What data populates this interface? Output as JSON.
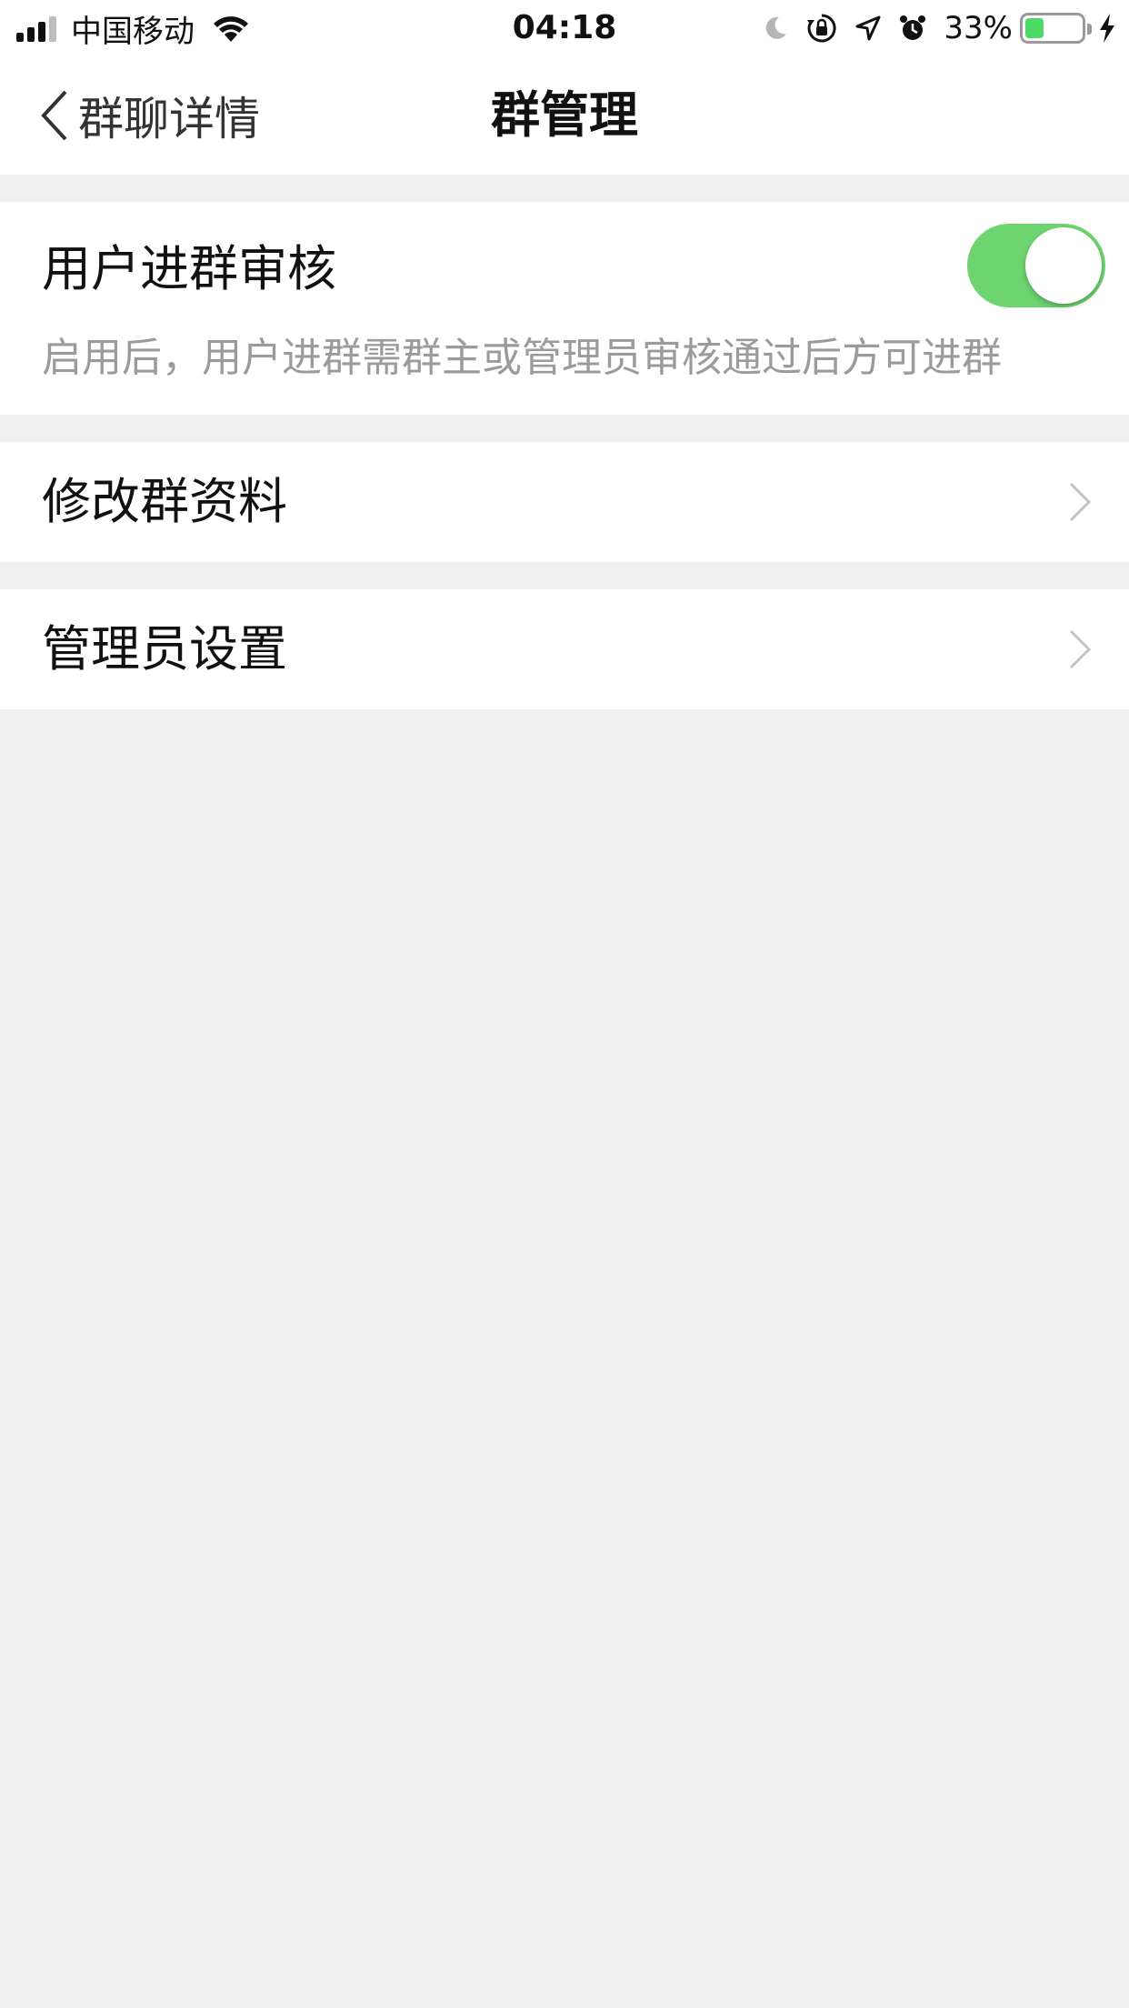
{
  "status_bar": {
    "carrier": "中国移动",
    "time": "04:18",
    "battery_percent": "33%",
    "battery_level": 0.33,
    "icons": [
      "signal-icon",
      "wifi-icon",
      "moon-icon",
      "orientation-lock-icon",
      "location-icon",
      "alarm-icon",
      "battery-icon",
      "charging-bolt-icon"
    ]
  },
  "nav": {
    "back_label": "群聊详情",
    "title": "群管理"
  },
  "settings": {
    "review": {
      "label": "用户进群审核",
      "description": "启用后，用户进群需群主或管理员审核通过后方可进群",
      "enabled": true
    },
    "edit_profile": {
      "label": "修改群资料"
    },
    "admin_settings": {
      "label": "管理员设置"
    }
  },
  "colors": {
    "accent_green": "#6dd470",
    "background": "#f0f0f0",
    "secondary_text": "#9b9b9b"
  }
}
